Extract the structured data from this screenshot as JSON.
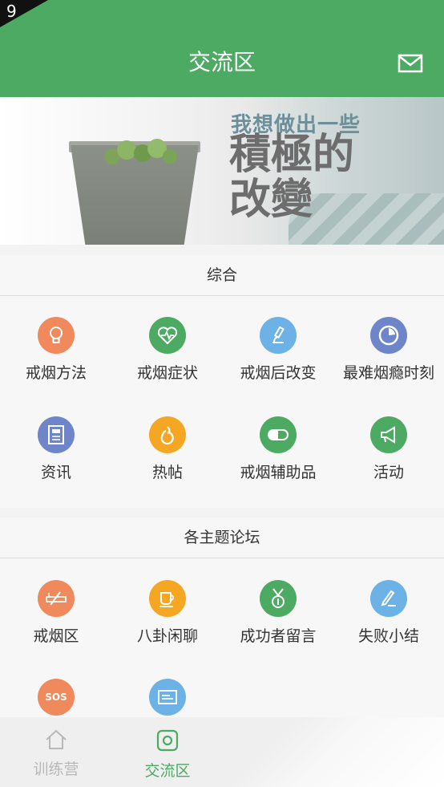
{
  "status": {
    "corner_text": "9"
  },
  "header": {
    "title": "交流区",
    "mail_icon": "mail-icon"
  },
  "banner": {
    "line1": "我想做出一些",
    "line2": "積極的",
    "line3": "改變"
  },
  "sections": [
    {
      "title": "综合",
      "items": [
        {
          "label": "戒烟方法",
          "icon": "lightbulb-icon",
          "color": "#f08a5d"
        },
        {
          "label": "戒烟症状",
          "icon": "heart-pulse-icon",
          "color": "#4caa62"
        },
        {
          "label": "戒烟后改变",
          "icon": "microscope-icon",
          "color": "#6cb2e6"
        },
        {
          "label": "最难烟瘾时刻",
          "icon": "clock-icon",
          "color": "#6e86c9"
        },
        {
          "label": "资讯",
          "icon": "newspaper-icon",
          "color": "#6e86c9"
        },
        {
          "label": "热帖",
          "icon": "fire-icon",
          "color": "#f5a623"
        },
        {
          "label": "戒烟辅助品",
          "icon": "pill-icon",
          "color": "#4caa62"
        },
        {
          "label": "活动",
          "icon": "megaphone-icon",
          "color": "#4caa62"
        }
      ]
    },
    {
      "title": "各主题论坛",
      "items": [
        {
          "label": "戒烟区",
          "icon": "no-smoking-icon",
          "color": "#f08a5d"
        },
        {
          "label": "八卦闲聊",
          "icon": "coffee-cup-icon",
          "color": "#f5a623"
        },
        {
          "label": "成功者留言",
          "icon": "medal-icon",
          "color": "#4caa62"
        },
        {
          "label": "失败小结",
          "icon": "pen-icon",
          "color": "#6cb2e6"
        },
        {
          "label": "",
          "icon": "sos-icon",
          "color": "#f08a5d",
          "icon_text": "SOS"
        },
        {
          "label": "",
          "icon": "card-icon",
          "color": "#6cb2e6"
        }
      ]
    }
  ],
  "tabbar": {
    "tabs": [
      {
        "label": "训练营",
        "icon": "home-icon",
        "active": false,
        "color": "#b8b8b8"
      },
      {
        "label": "交流区",
        "icon": "chat-icon",
        "active": true,
        "color": "#4caa62"
      }
    ]
  }
}
